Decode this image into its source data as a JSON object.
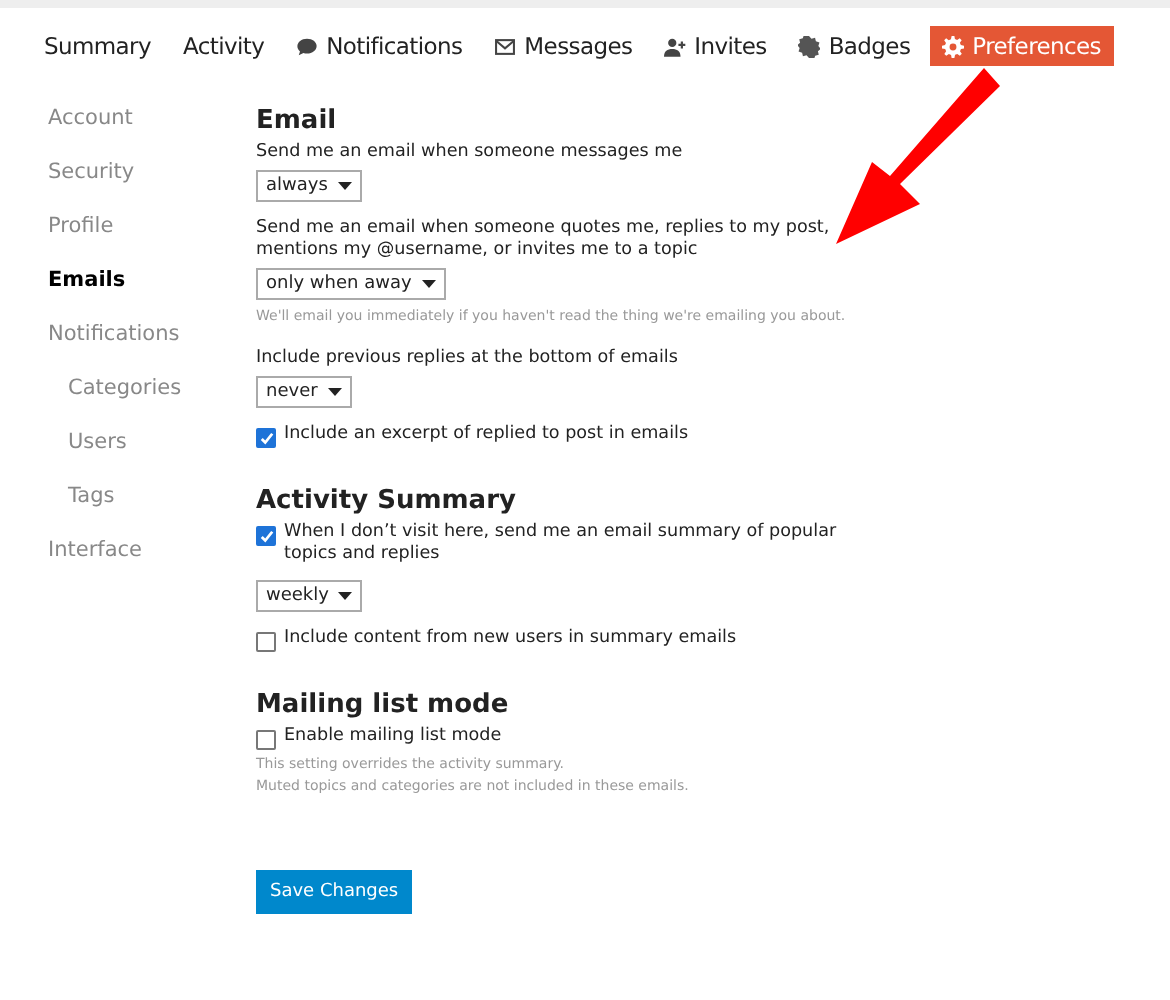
{
  "tabs": [
    {
      "label": "Summary",
      "selected": false
    },
    {
      "label": "Activity",
      "selected": false
    },
    {
      "label": "Notifications",
      "selected": false
    },
    {
      "label": "Messages",
      "selected": false
    },
    {
      "label": "Invites",
      "selected": false
    },
    {
      "label": "Badges",
      "selected": false
    },
    {
      "label": "Preferences",
      "selected": true
    }
  ],
  "sidebar": {
    "items": [
      {
        "label": "Account",
        "selected": false
      },
      {
        "label": "Security",
        "selected": false
      },
      {
        "label": "Profile",
        "selected": false
      },
      {
        "label": "Emails",
        "selected": true
      },
      {
        "label": "Notifications",
        "selected": false,
        "children": [
          {
            "label": "Categories",
            "selected": false
          },
          {
            "label": "Users",
            "selected": false
          },
          {
            "label": "Tags",
            "selected": false
          }
        ]
      },
      {
        "label": "Interface",
        "selected": false
      }
    ]
  },
  "sections": [
    {
      "title": "Email",
      "items": [
        {
          "kind": "select",
          "label": "Send me an email when someone messages me",
          "value": "always"
        },
        {
          "kind": "select",
          "label": "Send me an email when someone quotes me, replies to my post, mentions my @username, or invites me to a topic",
          "value": "only when away"
        },
        {
          "kind": "hint",
          "text": "We'll email you immediately if you haven't read the thing we're emailing you about."
        },
        {
          "kind": "select",
          "label": "Include previous replies at the bottom of emails",
          "value": "never"
        },
        {
          "kind": "checkbox",
          "label": "Include an excerpt of replied to post in emails",
          "checked": true
        }
      ]
    },
    {
      "title": "Activity Summary",
      "items": [
        {
          "kind": "checkbox",
          "label": "When I don’t visit here, send me an email summary of popular topics and replies",
          "checked": true
        },
        {
          "kind": "select",
          "value": "weekly"
        },
        {
          "kind": "checkbox",
          "label": "Include content from new users in summary emails",
          "checked": false
        }
      ]
    },
    {
      "title": "Mailing list mode",
      "items": [
        {
          "kind": "checkbox",
          "label": "Enable mailing list mode",
          "checked": false
        },
        {
          "kind": "hint",
          "text": "This setting overrides the activity summary."
        },
        {
          "kind": "hint",
          "text": "Muted topics and categories are not included in these emails."
        }
      ]
    }
  ],
  "save_button": "Save Changes"
}
